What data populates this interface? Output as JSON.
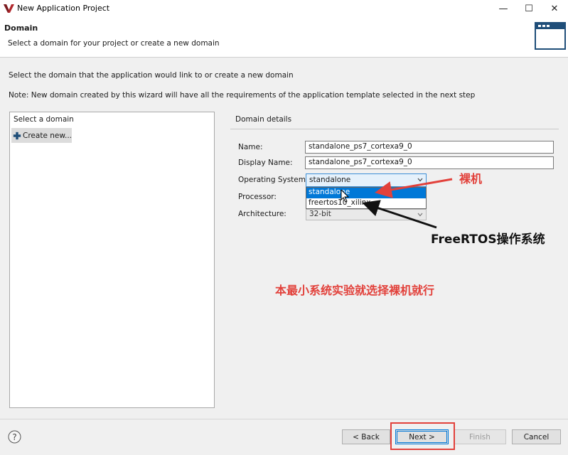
{
  "window": {
    "title": "New Application Project",
    "controls": {
      "minimize": "—",
      "maximize": "☐",
      "close": "✕"
    }
  },
  "header": {
    "title": "Domain",
    "subtitle": "Select a domain for your project or create a new domain"
  },
  "instruction": "Select the domain that the application would link to or create a new domain",
  "note": "Note: New domain created by this wizard will have all the requirements of the application template selected in the next step",
  "domain_list": {
    "header": "Select a domain",
    "items": [
      {
        "label": "Create new...",
        "icon": "plus-icon",
        "selected": true
      }
    ]
  },
  "details": {
    "title": "Domain details",
    "name_label": "Name:",
    "name_value": "standalone_ps7_cortexa9_0",
    "display_name_label": "Display Name:",
    "display_name_value": "standalone_ps7_cortexa9_0",
    "os_label": "Operating System:",
    "os_value": "standalone",
    "os_options": [
      "standalone",
      "freertos10_xilinx"
    ],
    "processor_label": "Processor:",
    "architecture_label": "Architecture:",
    "architecture_value": "32-bit"
  },
  "footer": {
    "back": "< Back",
    "next": "Next >",
    "finish": "Finish",
    "cancel": "Cancel",
    "help_icon": "?"
  },
  "annotations": {
    "bare_metal": "裸机",
    "freertos": "FreeRTOS操作系统",
    "summary": "本最小系统实验就选择裸机就行"
  },
  "colors": {
    "accent": "#0078d7",
    "annotation_red": "#e2413b",
    "annotation_black": "#111111"
  }
}
